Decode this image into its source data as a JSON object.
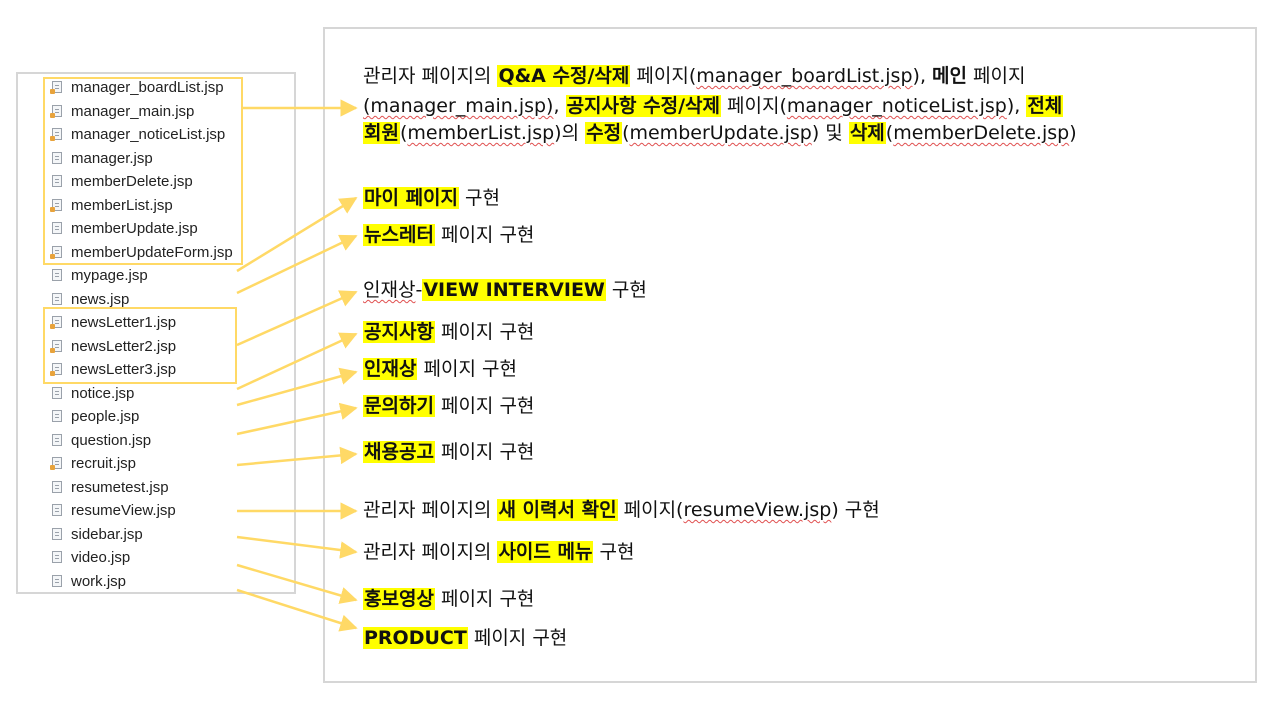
{
  "files": [
    {
      "name": "manager_boardList.jsp",
      "modified": true
    },
    {
      "name": "manager_main.jsp",
      "modified": true
    },
    {
      "name": "manager_noticeList.jsp",
      "modified": true
    },
    {
      "name": "manager.jsp",
      "modified": false
    },
    {
      "name": "memberDelete.jsp",
      "modified": false
    },
    {
      "name": "memberList.jsp",
      "modified": true
    },
    {
      "name": "memberUpdate.jsp",
      "modified": false
    },
    {
      "name": "memberUpdateForm.jsp",
      "modified": true
    },
    {
      "name": "mypage.jsp",
      "modified": false
    },
    {
      "name": "news.jsp",
      "modified": false
    },
    {
      "name": "newsLetter1.jsp",
      "modified": true
    },
    {
      "name": "newsLetter2.jsp",
      "modified": true
    },
    {
      "name": "newsLetter3.jsp",
      "modified": true
    },
    {
      "name": "notice.jsp",
      "modified": false
    },
    {
      "name": "people.jsp",
      "modified": false
    },
    {
      "name": "question.jsp",
      "modified": false
    },
    {
      "name": "recruit.jsp",
      "modified": true
    },
    {
      "name": "resumetest.jsp",
      "modified": false
    },
    {
      "name": "resumeView.jsp",
      "modified": false
    },
    {
      "name": "sidebar.jsp",
      "modified": false
    },
    {
      "name": "video.jsp",
      "modified": false
    },
    {
      "name": "work.jsp",
      "modified": false
    }
  ],
  "descriptions": [
    {
      "id": "manager",
      "lines": [
        [
          {
            "t": "관리자 페이지의 "
          },
          {
            "t": "Q&A 수정/삭제",
            "hl": true
          },
          {
            "t": " 페이지("
          },
          {
            "t": "manager_boardList.jsp",
            "sq": true
          },
          {
            "t": "), "
          },
          {
            "t": "메인",
            "b": true
          },
          {
            "t": " 페이지"
          }
        ],
        [
          {
            "t": "(manager_main.jsp)",
            "sq": true
          },
          {
            "t": ",  "
          },
          {
            "t": "공지사항 수정/삭제",
            "hl": true
          },
          {
            "t": " 페이지("
          },
          {
            "t": "manager_noticeList.jsp",
            "sq": true
          },
          {
            "t": "), "
          },
          {
            "t": "전체",
            "hl": true
          }
        ],
        [
          {
            "t": "회원",
            "hl": true
          },
          {
            "t": "("
          },
          {
            "t": "memberList.jsp",
            "sq": true
          },
          {
            "t": ")의 "
          },
          {
            "t": "수정",
            "hl": true
          },
          {
            "t": "("
          },
          {
            "t": "memberUpdate.jsp",
            "sq": true
          },
          {
            "t": ")  및 "
          },
          {
            "t": "삭제",
            "hl": true
          },
          {
            "t": "("
          },
          {
            "t": "memberDelete.jsp",
            "sq": true
          },
          {
            "t": ")"
          }
        ]
      ]
    },
    {
      "id": "mypage",
      "lines": [
        [
          {
            "t": "마이 페이지",
            "hl": true
          },
          {
            "t": " 구현"
          }
        ]
      ]
    },
    {
      "id": "newsletter",
      "lines": [
        [
          {
            "t": "뉴스레터",
            "hl": true
          },
          {
            "t": " 페이지 구현"
          }
        ]
      ]
    },
    {
      "id": "interview",
      "lines": [
        [
          {
            "t": "인재상",
            "sq": true
          },
          {
            "t": "-"
          },
          {
            "t": "VIEW INTERVIEW",
            "hl": true
          },
          {
            "t": " 구현"
          }
        ]
      ]
    },
    {
      "id": "notice",
      "lines": [
        [
          {
            "t": "공지사항",
            "hl": true
          },
          {
            "t": " 페이지 구현"
          }
        ]
      ]
    },
    {
      "id": "people",
      "lines": [
        [
          {
            "t": "인재상",
            "hl": true
          },
          {
            "t": " 페이지 구현"
          }
        ]
      ]
    },
    {
      "id": "question",
      "lines": [
        [
          {
            "t": "문의하기",
            "hl": true
          },
          {
            "t": " 페이지 구현"
          }
        ]
      ]
    },
    {
      "id": "recruit",
      "lines": [
        [
          {
            "t": "채용공고",
            "hl": true
          },
          {
            "t": " 페이지 구현"
          }
        ]
      ]
    },
    {
      "id": "resume",
      "lines": [
        [
          {
            "t": "관리자 페이지의 "
          },
          {
            "t": "새 이력서 확인",
            "hl": true
          },
          {
            "t": " 페이지("
          },
          {
            "t": "resumeView.jsp",
            "sq": true
          },
          {
            "t": ") 구현"
          }
        ]
      ]
    },
    {
      "id": "sidebar",
      "lines": [
        [
          {
            "t": "관리자 페이지의 "
          },
          {
            "t": "사이드 메뉴",
            "hl": true
          },
          {
            "t": " 구현"
          }
        ]
      ]
    },
    {
      "id": "video",
      "lines": [
        [
          {
            "t": "홍보영상",
            "hl": true
          },
          {
            "t": " 페이지 구현"
          }
        ]
      ]
    },
    {
      "id": "product",
      "lines": [
        [
          {
            "t": "PRODUCT",
            "hl": true
          },
          {
            "t": " 페이지 구현"
          }
        ]
      ]
    }
  ],
  "colors": {
    "highlight": "#ffff00",
    "arrow": "#ffd966",
    "border": "#d6d6d6",
    "squiggle": "#e05050"
  }
}
